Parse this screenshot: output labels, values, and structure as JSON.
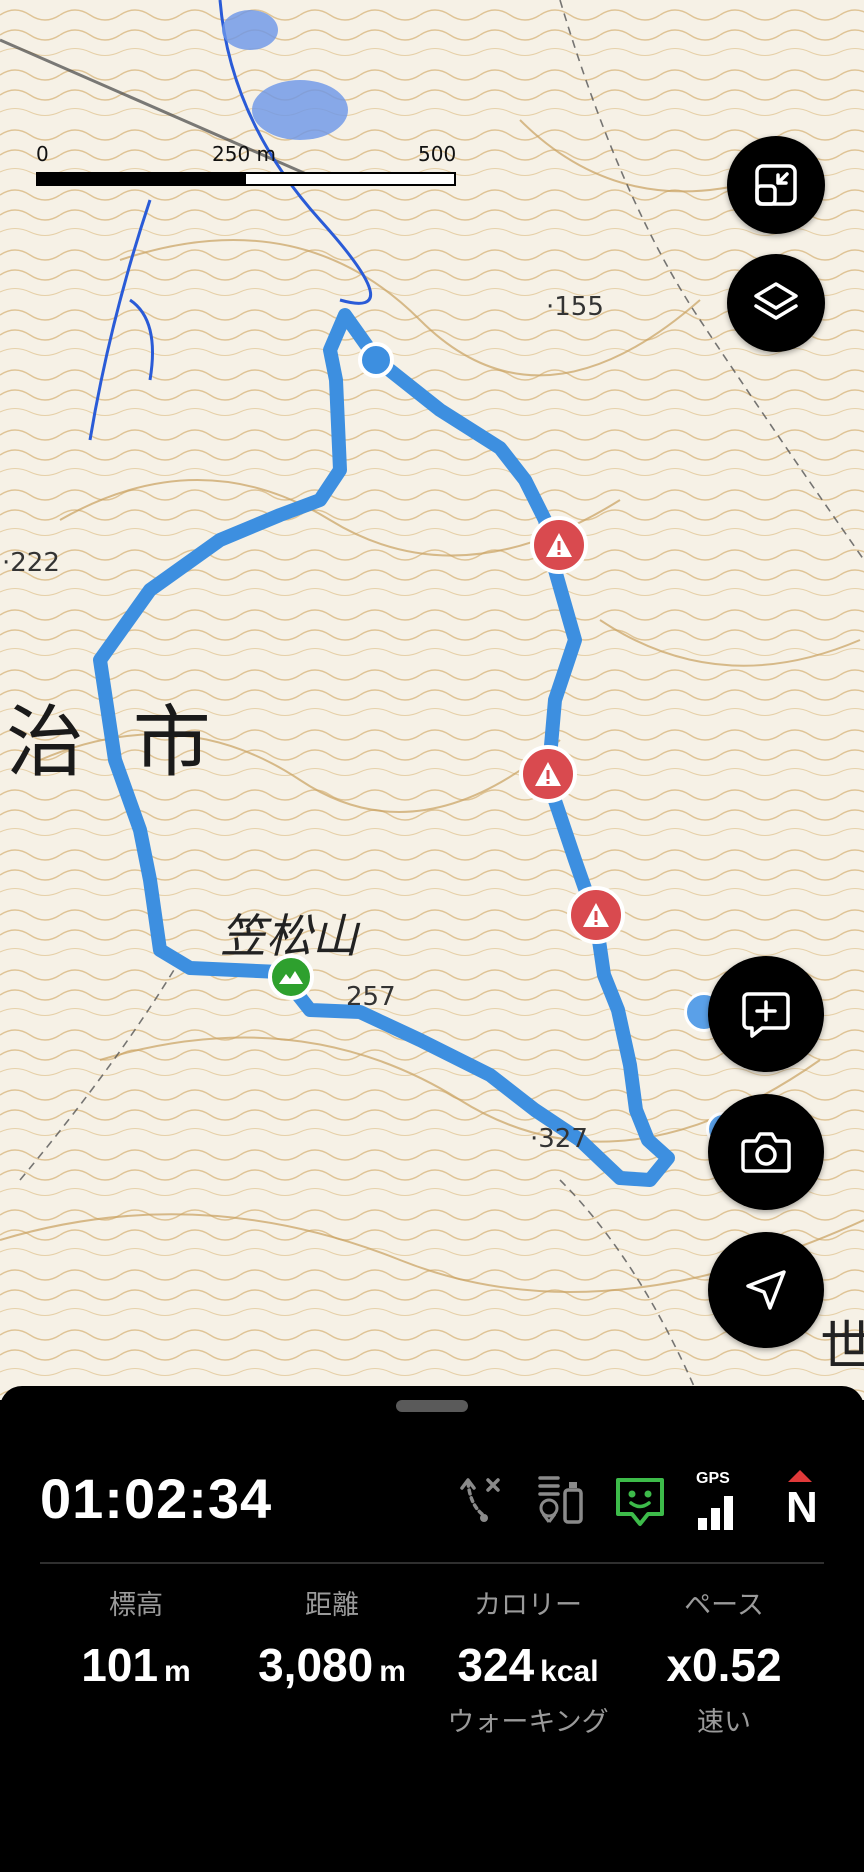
{
  "map": {
    "place_name": "治 市",
    "peak_name": "笠松山",
    "edge_label": "世",
    "elevations": {
      "e155": "155",
      "e222": "222",
      "e257": "257",
      "e327": "327"
    },
    "scale": {
      "tick_0": "0",
      "tick_250": "250 m",
      "tick_500": "500 m"
    }
  },
  "buttons": {
    "fit_route": "fit-route-icon",
    "layers": "layers-icon",
    "add_memo": "add-memo-icon",
    "camera": "camera-icon",
    "current_location": "navigation-arrow-icon"
  },
  "panel": {
    "elapsed_time": "01:02:34",
    "status_icons": [
      "route-off-icon",
      "battery-icon",
      "face-status-icon",
      "gps-signal-icon",
      "compass-north-icon"
    ],
    "gps_label": "GPS",
    "compass_label": "N",
    "stats": {
      "altitude": {
        "label": "標高",
        "value": "101",
        "unit": "m"
      },
      "distance": {
        "label": "距離",
        "value": "3,080",
        "unit": "m"
      },
      "calories": {
        "label": "カロリー",
        "value": "324",
        "unit": "kcal",
        "sub": "ウォーキング"
      },
      "pace": {
        "label": "ペース",
        "value": "x0.52",
        "sub": "速い"
      }
    }
  },
  "colors": {
    "route": "#3d8fe0",
    "warning": "#d94a4f",
    "summit": "#2ea02e",
    "face_icon": "#3dbb4a"
  }
}
